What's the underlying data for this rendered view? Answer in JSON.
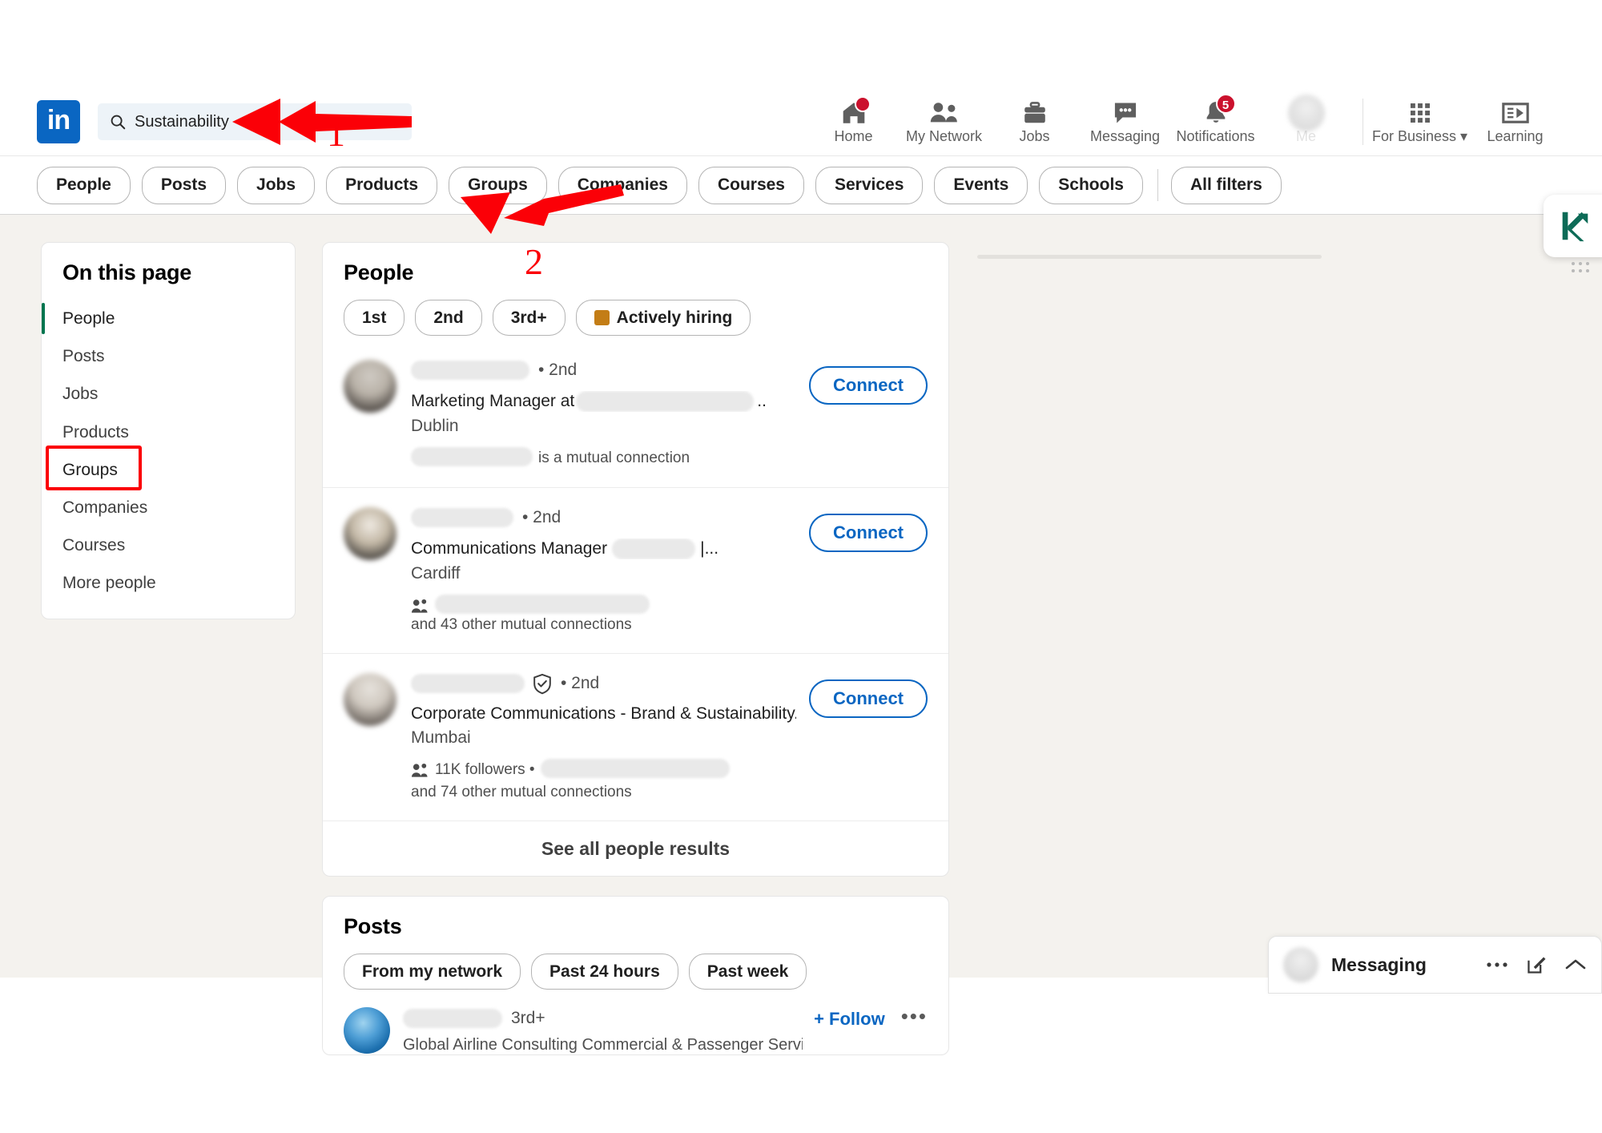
{
  "brand": {
    "logo_text": "in",
    "accent": "#0a66c2",
    "badge_color": "#cb112d",
    "annotation_color": "#fb0007",
    "highlight_color": "#01754f"
  },
  "search": {
    "query": "Sustainability",
    "icon": "search-icon"
  },
  "nav": {
    "items": [
      {
        "label": "Home",
        "icon": "home-icon",
        "badge": ""
      },
      {
        "label": "My Network",
        "icon": "people-icon",
        "badge": ""
      },
      {
        "label": "Jobs",
        "icon": "briefcase-icon",
        "badge": ""
      },
      {
        "label": "Messaging",
        "icon": "message-icon",
        "badge": ""
      },
      {
        "label": "Notifications",
        "icon": "bell-icon",
        "badge": "5"
      }
    ],
    "me_label": "Me",
    "for_business": "For Business",
    "learning": "Learning"
  },
  "filters": {
    "pills": [
      "People",
      "Posts",
      "Jobs",
      "Products",
      "Groups",
      "Companies",
      "Courses",
      "Services",
      "Events",
      "Schools"
    ],
    "all_filters": "All filters"
  },
  "sidebar": {
    "title": "On this page",
    "items": [
      {
        "label": "People",
        "state": "active"
      },
      {
        "label": "Posts",
        "state": ""
      },
      {
        "label": "Jobs",
        "state": ""
      },
      {
        "label": "Products",
        "state": ""
      },
      {
        "label": "Groups",
        "state": "highlighted"
      },
      {
        "label": "Companies",
        "state": ""
      },
      {
        "label": "Courses",
        "state": ""
      },
      {
        "label": "More people",
        "state": ""
      }
    ]
  },
  "people_section": {
    "heading": "People",
    "chips": [
      {
        "label": "1st",
        "icon": ""
      },
      {
        "label": "2nd",
        "icon": ""
      },
      {
        "label": "3rd+",
        "icon": ""
      },
      {
        "label": "Actively hiring",
        "icon": "hiring-square-icon"
      }
    ],
    "results": [
      {
        "name_redacted": true,
        "degree": "• 2nd",
        "verified": false,
        "title_prefix": "Marketing Manager at",
        "title_suffix": "..",
        "location": "Dublin",
        "mutual_prefix": "",
        "mutual_suffix": "is a mutual connection",
        "mutual_icon": false,
        "action": "Connect"
      },
      {
        "name_redacted": true,
        "degree": "• 2nd",
        "verified": false,
        "title_prefix": "Communications Manager",
        "title_suffix": "|...",
        "location": "Cardiff",
        "mutual_prefix": "",
        "mutual_suffix": "and 43 other mutual connections",
        "mutual_bold": "43",
        "mutual_icon": true,
        "action": "Connect"
      },
      {
        "name_redacted": true,
        "degree": "• 2nd",
        "verified": true,
        "title_prefix": "Corporate Communications - Brand & Sustainability...",
        "title_suffix": "",
        "location": "Mumbai",
        "mutual_prefix": "11K followers •",
        "mutual_suffix": "and 74 other mutual connections",
        "mutual_bold": "74",
        "mutual_icon": true,
        "action": "Connect"
      }
    ],
    "see_all": "See all people results"
  },
  "posts_section": {
    "heading": "Posts",
    "chips": [
      "From my network",
      "Past 24 hours",
      "Past week"
    ],
    "first_post": {
      "name_redacted": true,
      "degree": "3rd+",
      "headline": "Global Airline Consulting Commercial & Passenger Services...",
      "follow_label": "+ Follow",
      "more_label": "•••"
    }
  },
  "messaging_dock": {
    "title": "Messaging",
    "icons": [
      "more-icon",
      "compose-icon",
      "chevron-up-icon"
    ]
  },
  "k_widget": {
    "name": "k-arrow-logo",
    "color": "#0d6b57"
  },
  "annotations": [
    {
      "id": "1",
      "label": "1",
      "target": "search-input"
    },
    {
      "id": "2",
      "label": "2",
      "target": "filter-bar"
    }
  ]
}
